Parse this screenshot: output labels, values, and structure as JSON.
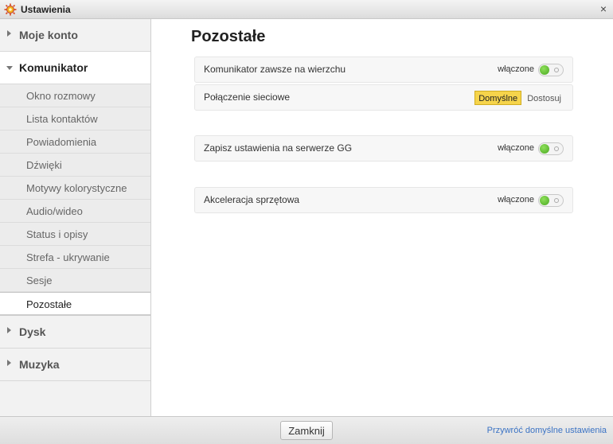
{
  "window": {
    "title": "Ustawienia",
    "app_icon": "gear-sun-icon",
    "close_glyph": "×"
  },
  "sidebar": {
    "categories": [
      {
        "label": "Moje konto",
        "expanded": false
      },
      {
        "label": "Komunikator",
        "expanded": true,
        "items": [
          {
            "label": "Okno rozmowy"
          },
          {
            "label": "Lista kontaktów"
          },
          {
            "label": "Powiadomienia"
          },
          {
            "label": "Dźwięki"
          },
          {
            "label": "Motywy kolorystyczne"
          },
          {
            "label": "Audio/wideo"
          },
          {
            "label": "Status i opisy"
          },
          {
            "label": "Strefa - ukrywanie"
          },
          {
            "label": "Sesje"
          },
          {
            "label": "Pozostałe",
            "active": true
          }
        ]
      },
      {
        "label": "Dysk",
        "expanded": false
      },
      {
        "label": "Muzyka",
        "expanded": false
      }
    ]
  },
  "main": {
    "title": "Pozostałe",
    "settings": [
      {
        "label": "Komunikator zawsze na wierzchu",
        "state_text": "włączone",
        "on": true
      },
      {
        "label": "Połączenie sieciowe",
        "options": [
          "Domyślne",
          "Dostosuj"
        ],
        "selected": "Domyślne"
      },
      {
        "label": "Zapisz ustawienia na serwerze GG",
        "state_text": "włączone",
        "on": true
      },
      {
        "label": "Akceleracja sprzętowa",
        "state_text": "włączone",
        "on": true
      }
    ]
  },
  "footer": {
    "close_label": "Zamknij",
    "restore_label": "Przywróć domyślne ustawienia"
  },
  "colors": {
    "toggle_on": "#4ba822",
    "selected_option": "#f6d44b",
    "link": "#3b73c4"
  }
}
